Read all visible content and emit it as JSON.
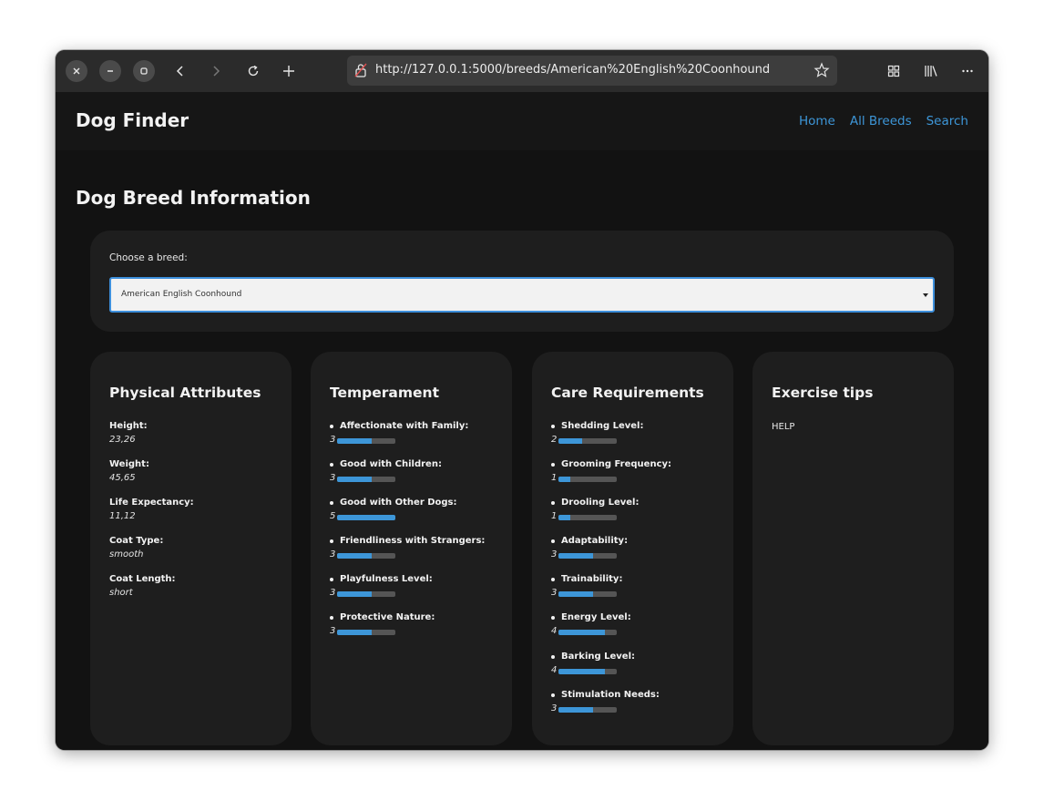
{
  "browser": {
    "url": "http://127.0.0.1:5000/breeds/American%20English%20Coonhound"
  },
  "site": {
    "brand": "Dog Finder",
    "nav": [
      "Home",
      "All Breeds",
      "Search"
    ]
  },
  "page_title": "Dog Breed Information",
  "selector": {
    "label": "Choose a breed:",
    "selected": "American English Coonhound"
  },
  "physical": {
    "title": "Physical Attributes",
    "items": [
      {
        "label": "Height:",
        "value": "23,26"
      },
      {
        "label": "Weight:",
        "value": "45,65"
      },
      {
        "label": "Life Expectancy:",
        "value": "11,12"
      },
      {
        "label": "Coat Type:",
        "value": "smooth"
      },
      {
        "label": "Coat Length:",
        "value": "short"
      }
    ]
  },
  "temperament": {
    "title": "Temperament",
    "max": 5,
    "items": [
      {
        "label": "Affectionate with Family:",
        "value": "3"
      },
      {
        "label": "Good with Children:",
        "value": "3"
      },
      {
        "label": "Good with Other Dogs:",
        "value": "5"
      },
      {
        "label": "Friendliness with Strangers:",
        "value": "3"
      },
      {
        "label": "Playfulness Level:",
        "value": "3"
      },
      {
        "label": "Protective Nature:",
        "value": "3"
      }
    ]
  },
  "care": {
    "title": "Care Requirements",
    "max": 5,
    "items": [
      {
        "label": "Shedding Level:",
        "value": "2"
      },
      {
        "label": "Grooming Frequency:",
        "value": "1"
      },
      {
        "label": "Drooling Level:",
        "value": "1"
      },
      {
        "label": "Adaptability:",
        "value": "3"
      },
      {
        "label": "Trainability:",
        "value": "3"
      },
      {
        "label": "Energy Level:",
        "value": "4"
      },
      {
        "label": "Barking Level:",
        "value": "4"
      },
      {
        "label": "Stimulation Needs:",
        "value": "3"
      }
    ]
  },
  "exercise": {
    "title": "Exercise tips",
    "text": "HELP"
  },
  "colors": {
    "accent": "#3d96d8",
    "card_bg": "#1e1e1e",
    "page_bg": "#121212"
  }
}
